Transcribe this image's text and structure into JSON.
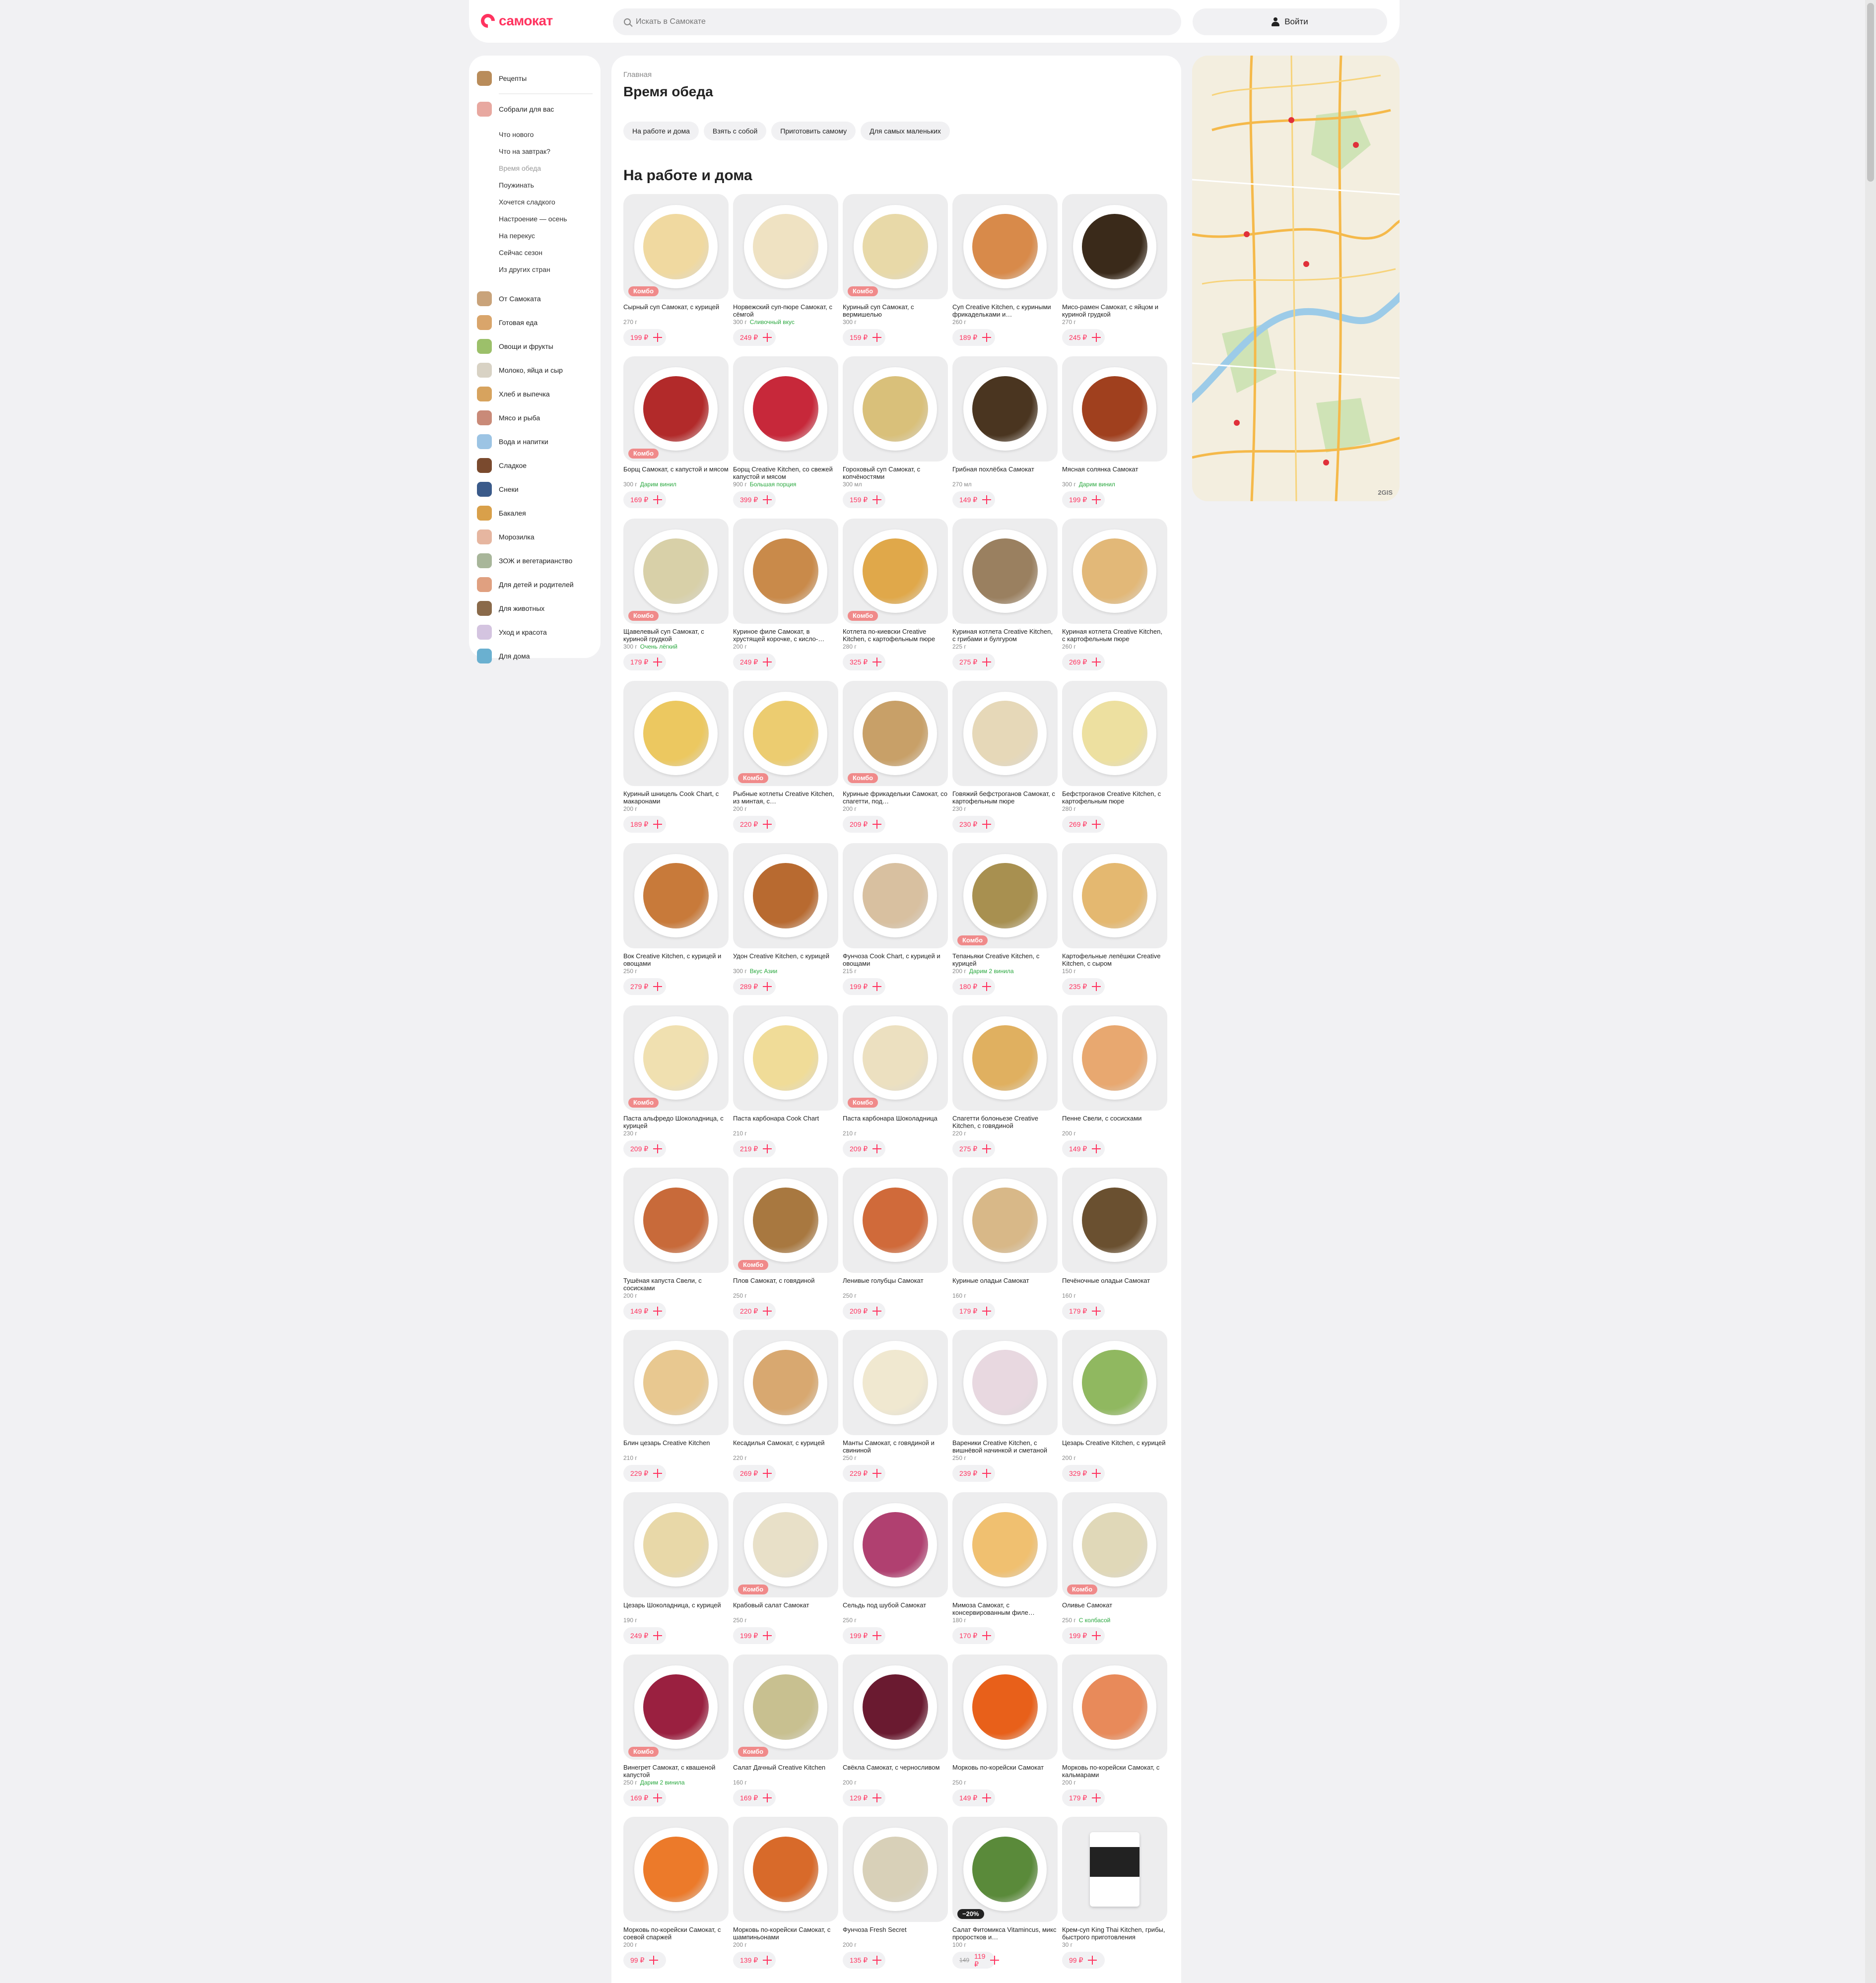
{
  "header": {
    "logo": "самокат",
    "search_placeholder": "Искать в Самокате",
    "login": "Войти"
  },
  "sidebar": {
    "top": [
      {
        "label": "Рецепты",
        "color": "#b98c5a"
      },
      {
        "label": "Собрали для вас",
        "color": "#e8a8a0"
      }
    ],
    "subs": [
      "Что нового",
      "Что на завтрак?",
      "Время обеда",
      "Поужинать",
      "Хочется сладкого",
      "Настроение — осень",
      "На перекус",
      "Сейчас сезон",
      "Из других стран"
    ],
    "categories": [
      {
        "label": "От Самоката",
        "color": "#c9a37a"
      },
      {
        "label": "Готовая еда",
        "color": "#d9a56b"
      },
      {
        "label": "Овощи и фрукты",
        "color": "#9cc06a"
      },
      {
        "label": "Молоко, яйца и сыр",
        "color": "#d8d2c4"
      },
      {
        "label": "Хлеб и выпечка",
        "color": "#d7a35e"
      },
      {
        "label": "Мясо и рыба",
        "color": "#c98a78"
      },
      {
        "label": "Вода и напитки",
        "color": "#9cc4e4"
      },
      {
        "label": "Сладкое",
        "color": "#7a4a2e"
      },
      {
        "label": "Снеки",
        "color": "#3a5a8a"
      },
      {
        "label": "Бакалея",
        "color": "#d9a04a"
      },
      {
        "label": "Морозилка",
        "color": "#e6b6a0"
      },
      {
        "label": "ЗОЖ и вегетарианство",
        "color": "#a8b69a"
      },
      {
        "label": "Для детей и родителей",
        "color": "#e0a080"
      },
      {
        "label": "Для животных",
        "color": "#8a6a4a"
      },
      {
        "label": "Уход и красота",
        "color": "#d4c4e0"
      },
      {
        "label": "Для дома",
        "color": "#6ab0d0"
      }
    ]
  },
  "main": {
    "breadcrumb": "Главная",
    "title": "Время обеда",
    "chips": [
      "На работе и дома",
      "Взять с собой",
      "Приготовить самому",
      "Для самых маленьких"
    ],
    "section_title": "На работе и дома"
  },
  "products": [
    {
      "name": "Сырный суп Самокат, с курицей",
      "weight": "270 г",
      "price": "199 ₽",
      "badge": "Комбо",
      "color": "#f0d9a0"
    },
    {
      "name": "Норвежский суп-пюре Самокат, с сёмгой",
      "weight": "300 г",
      "promo": "Сливочный вкус",
      "price": "249 ₽",
      "color": "#efe2c2"
    },
    {
      "name": "Куриный суп Самокат, с вермишелью",
      "weight": "300 г",
      "price": "159 ₽",
      "badge": "Комбо",
      "color": "#e8d9a8"
    },
    {
      "name": "Суп Creative Kitchen, с куриными фрикадельками и…",
      "weight": "260 г",
      "price": "189 ₽",
      "color": "#d88a4a"
    },
    {
      "name": "Мисо-рамен Самокат, с яйцом и куриной грудкой",
      "weight": "270 г",
      "price": "245 ₽",
      "color": "#3a2a1a"
    },
    {
      "name": "Борщ Самокат, с капустой и мясом",
      "weight": "300 г",
      "promo": "Дарим винил",
      "price": "169 ₽",
      "badge": "Комбо",
      "color": "#b22a2a"
    },
    {
      "name": "Борщ Creative Kitchen, со свежей капустой и мясом",
      "weight": "900 г",
      "promo": "Большая порция",
      "price": "399 ₽",
      "color": "#c7283a"
    },
    {
      "name": "Гороховый суп Самокат, с копчёностями",
      "weight": "300 мл",
      "price": "159 ₽",
      "color": "#d9c07a"
    },
    {
      "name": "Грибная похлёбка Самокат",
      "weight": "270 мл",
      "price": "149 ₽",
      "color": "#4a3520"
    },
    {
      "name": "Мясная солянка Самокат",
      "weight": "300 г",
      "promo": "Дарим винил",
      "price": "199 ₽",
      "color": "#a0401e"
    },
    {
      "name": "Щавелевый суп Самокат, с куриной грудкой",
      "weight": "300 г",
      "promo": "Очень лёгкий",
      "price": "179 ₽",
      "badge": "Комбо",
      "color": "#d8d0a8"
    },
    {
      "name": "Куриное филе Самокат, в хрустящей корочке, с кисло-…",
      "weight": "200 г",
      "price": "249 ₽",
      "color": "#c98a4a"
    },
    {
      "name": "Котлета по-киевски Creative Kitchen, с картофельным пюре",
      "weight": "280 г",
      "price": "325 ₽",
      "badge": "Комбо",
      "color": "#e0a84a"
    },
    {
      "name": "Куриная котлета Creative Kitchen, с грибами и булгуром",
      "weight": "225 г",
      "price": "275 ₽",
      "color": "#9a8060"
    },
    {
      "name": "Куриная котлета Creative Kitchen, с картофельным пюре",
      "weight": "260 г",
      "price": "269 ₽",
      "color": "#e2b878"
    },
    {
      "name": "Куриный шницель Cook Chart, с макаронами",
      "weight": "200 г",
      "price": "189 ₽",
      "color": "#ecc860"
    },
    {
      "name": "Рыбные котлеты Creative Kitchen, из минтая, с…",
      "weight": "200 г",
      "price": "220 ₽",
      "badge": "Комбо",
      "color": "#eccc70"
    },
    {
      "name": "Куриные фрикадельки Самокат, со спагетти, под…",
      "weight": "200 г",
      "price": "209 ₽",
      "badge": "Комбо",
      "color": "#c8a068"
    },
    {
      "name": "Говяжий бефстроганов Самокат, с картофельным пюре",
      "weight": "230 г",
      "price": "230 ₽",
      "color": "#e6d8b8"
    },
    {
      "name": "Бефстроганов Creative Kitchen, с картофельным пюре",
      "weight": "280 г",
      "price": "269 ₽",
      "color": "#ede0a0"
    },
    {
      "name": "Вок Creative Kitchen, с курицей и овощами",
      "weight": "250 г",
      "price": "279 ₽",
      "color": "#c87a3a"
    },
    {
      "name": "Удон Creative Kitchen, с курицей",
      "weight": "300 г",
      "promo": "Вкус Азии",
      "price": "289 ₽",
      "color": "#b86a30"
    },
    {
      "name": "Фунчоза Cook Chart, с курицей и овощами",
      "weight": "215 г",
      "price": "199 ₽",
      "color": "#d8c0a0"
    },
    {
      "name": "Тепаньяки Creative Kitchen, с курицей",
      "weight": "200 г",
      "promo": "Дарим 2 винила",
      "price": "180 ₽",
      "badge": "Комбо",
      "color": "#a89050"
    },
    {
      "name": "Картофельные лепёшки Creative Kitchen, с сыром",
      "weight": "150 г",
      "price": "235 ₽",
      "color": "#e4b870"
    },
    {
      "name": "Паста альфредо Шоколадница, с курицей",
      "weight": "230 г",
      "price": "209 ₽",
      "badge": "Комбо",
      "color": "#f0e0b0"
    },
    {
      "name": "Паста карбонара Cook Chart",
      "weight": "210 г",
      "price": "219 ₽",
      "color": "#f0dc98"
    },
    {
      "name": "Паста карбонара Шоколадница",
      "weight": "210 г",
      "price": "209 ₽",
      "badge": "Комбо",
      "color": "#ece0c0"
    },
    {
      "name": "Спагетти болоньезе Creative Kitchen, с говядиной",
      "weight": "220 г",
      "price": "275 ₽",
      "color": "#e0b060"
    },
    {
      "name": "Пенне Свели, с сосисками",
      "weight": "200 г",
      "price": "149 ₽",
      "color": "#e8a870"
    },
    {
      "name": "Тушёная капуста Свели, с сосисками",
      "weight": "200 г",
      "price": "149 ₽",
      "color": "#c86a3a"
    },
    {
      "name": "Плов Самокат, с говядиной",
      "weight": "250 г",
      "price": "220 ₽",
      "badge": "Комбо",
      "color": "#a87840"
    },
    {
      "name": "Ленивые голубцы Самокат",
      "weight": "250 г",
      "price": "209 ₽",
      "color": "#d06a3a"
    },
    {
      "name": "Куриные оладьи Самокат",
      "weight": "160 г",
      "price": "179 ₽",
      "color": "#d8b888"
    },
    {
      "name": "Печёночные оладьи Самокат",
      "weight": "160 г",
      "price": "179 ₽",
      "color": "#6a5030"
    },
    {
      "name": "Блин цезарь Creative Kitchen",
      "weight": "210 г",
      "price": "229 ₽",
      "color": "#e8c890"
    },
    {
      "name": "Кесадилья Самокат, с курицей",
      "weight": "220 г",
      "price": "269 ₽",
      "color": "#d8a870"
    },
    {
      "name": "Манты Самокат, с говядиной и свининой",
      "weight": "250 г",
      "price": "229 ₽",
      "color": "#f0e8d0"
    },
    {
      "name": "Вареники Creative Kitchen, с вишнёвой начинкой и сметаной",
      "weight": "250 г",
      "price": "239 ₽",
      "color": "#e8d8e0"
    },
    {
      "name": "Цезарь Creative Kitchen, с курицей",
      "weight": "200 г",
      "price": "329 ₽",
      "color": "#90b860"
    },
    {
      "name": "Цезарь Шоколадница, с курицей",
      "weight": "190 г",
      "price": "249 ₽",
      "color": "#e8d8a8"
    },
    {
      "name": "Крабовый салат Самокат",
      "weight": "250 г",
      "price": "199 ₽",
      "badge": "Комбо",
      "color": "#e8e0c8"
    },
    {
      "name": "Сельдь под шубой Самокат",
      "weight": "250 г",
      "price": "199 ₽",
      "color": "#b04070"
    },
    {
      "name": "Мимоза Самокат, с консервированным филе…",
      "weight": "180 г",
      "price": "170 ₽",
      "color": "#f0c070"
    },
    {
      "name": "Оливье Самокат",
      "weight": "250 г",
      "promo": "С колбасой",
      "price": "199 ₽",
      "badge": "Комбо",
      "color": "#e0d8b8"
    },
    {
      "name": "Винегрет Самокат, с квашеной капустой",
      "weight": "250 г",
      "promo": "Дарим 2 винила",
      "price": "169 ₽",
      "badge": "Комбо",
      "color": "#9a2040"
    },
    {
      "name": "Салат Дачный Creative Kitchen",
      "weight": "160 г",
      "price": "169 ₽",
      "badge": "Комбо",
      "color": "#c8c090"
    },
    {
      "name": "Свёкла Самокат, с черносливом",
      "weight": "200 г",
      "price": "129 ₽",
      "color": "#6a1a30"
    },
    {
      "name": "Морковь по-корейски Самокат",
      "weight": "250 г",
      "price": "149 ₽",
      "color": "#e8601a"
    },
    {
      "name": "Морковь по-корейски Самокат, с кальмарами",
      "weight": "200 г",
      "price": "179 ₽",
      "color": "#e88a5a"
    },
    {
      "name": "Морковь по-корейски Самокат, с соевой спаржей",
      "weight": "200 г",
      "price": "99 ₽",
      "color": "#ec7a2a"
    },
    {
      "name": "Морковь по-корейски Самокат, с шампиньонами",
      "weight": "200 г",
      "price": "139 ₽",
      "color": "#d86a2a"
    },
    {
      "name": "Фунчоза Fresh Secret",
      "weight": "200 г",
      "price": "135 ₽",
      "color": "#d8d0b8"
    },
    {
      "name": "Салат Фитомикса Vitamincus, микс проростков и…",
      "weight": "100 г",
      "old_price": "149",
      "price": "119 ₽",
      "badge": "−20%",
      "badge_kind": "disc",
      "color": "#5a8a3a"
    },
    {
      "name": "Крем-суп King Thai Kitchen, грибы, быстрого приготовления",
      "weight": "30 г",
      "price": "99 ₽",
      "kind": "cup",
      "color": "#222222"
    }
  ],
  "map": {
    "attribution": "2GIS"
  }
}
